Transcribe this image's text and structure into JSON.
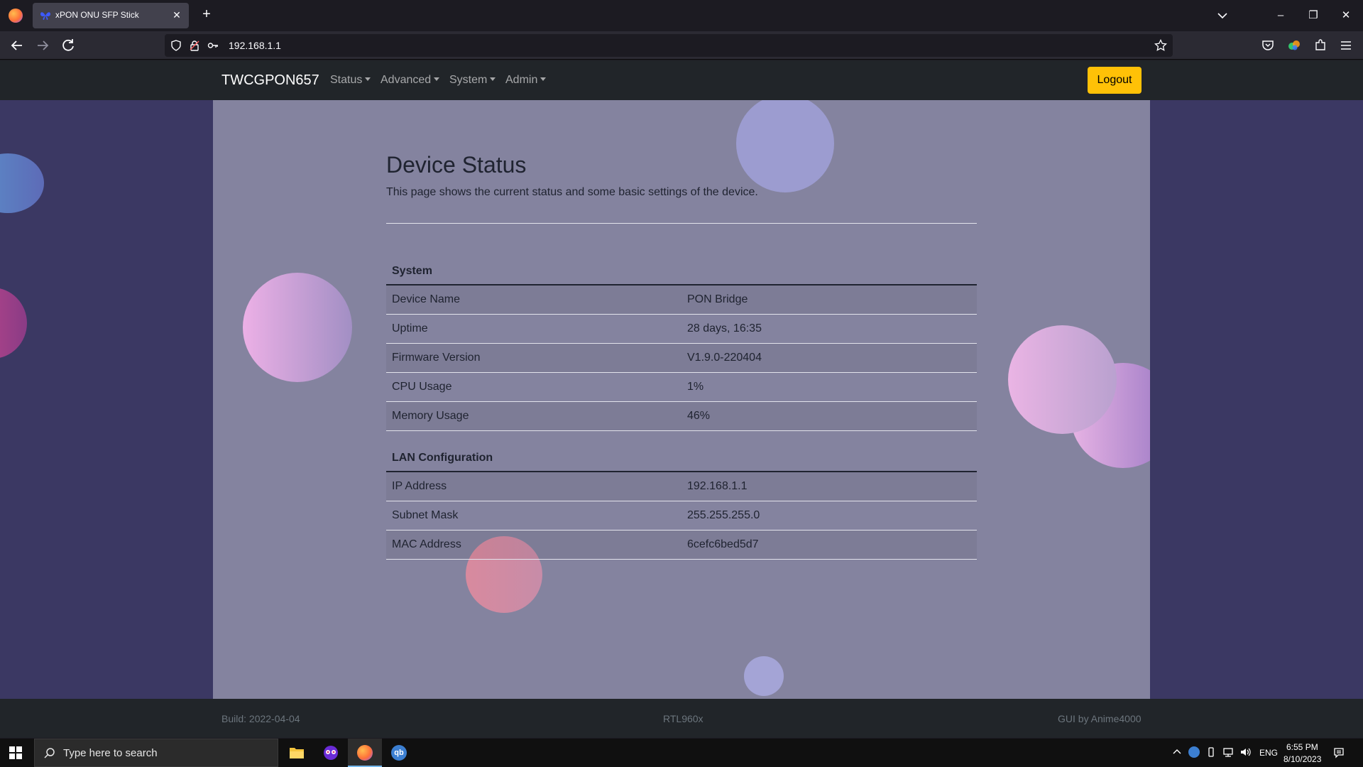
{
  "browser": {
    "tab_title": "xPON ONU SFP Stick",
    "url": "192.168.1.1"
  },
  "app": {
    "brand": "TWCGPON657",
    "menu": [
      "Status",
      "Advanced",
      "System",
      "Admin"
    ],
    "logout_label": "Logout"
  },
  "page": {
    "title": "Device Status",
    "description": "This page shows the current status and some basic settings of the device.",
    "sections": [
      {
        "heading": "System",
        "rows": [
          {
            "key": "Device Name",
            "value": "PON Bridge"
          },
          {
            "key": "Uptime",
            "value": "28 days, 16:35"
          },
          {
            "key": "Firmware Version",
            "value": "V1.9.0-220404"
          },
          {
            "key": "CPU Usage",
            "value": "1%"
          },
          {
            "key": "Memory Usage",
            "value": "46%"
          }
        ]
      },
      {
        "heading": "LAN Configuration",
        "rows": [
          {
            "key": "IP Address",
            "value": "192.168.1.1"
          },
          {
            "key": "Subnet Mask",
            "value": "255.255.255.0"
          },
          {
            "key": "MAC Address",
            "value": "6cefc6bed5d7"
          }
        ]
      }
    ]
  },
  "footer": {
    "build": "Build: 2022-04-04",
    "chip": "RTL960x",
    "credit": "GUI by Anime4000"
  },
  "taskbar": {
    "search_placeholder": "Type here to search",
    "language": "ENG",
    "time": "6:55 PM",
    "date": "8/10/2023"
  },
  "colors": {
    "accent": "#ffc107",
    "navbar": "#212529",
    "page_bg": "#3b3863",
    "content_bg": "#84839f"
  }
}
